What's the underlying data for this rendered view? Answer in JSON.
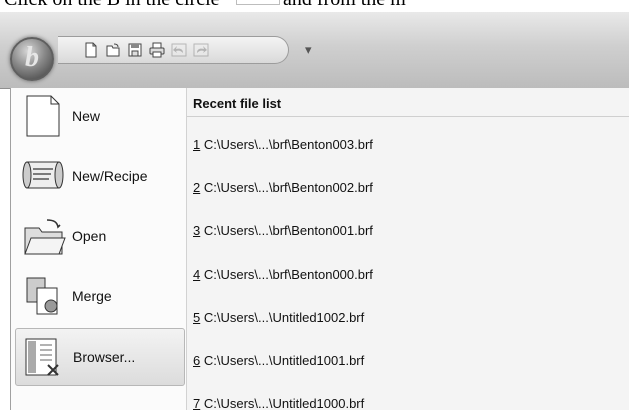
{
  "caption": {
    "left": "Click on the B in the circle",
    "right": "and from the m"
  },
  "app": {
    "orb_letter": "b"
  },
  "quick_access": {
    "icons": [
      "new-document-icon",
      "open-folder-icon",
      "save-icon",
      "print-icon",
      "undo-icon",
      "redo-icon"
    ],
    "more": "▾"
  },
  "menu": {
    "commands": [
      {
        "label": "New",
        "icon": "blank-document-icon"
      },
      {
        "label": "New/Recipe",
        "icon": "recipe-scroll-icon"
      },
      {
        "label": "Open",
        "icon": "folder-open-icon"
      },
      {
        "label": "Merge",
        "icon": "merge-documents-icon"
      },
      {
        "label": "Browser...",
        "icon": "browser-icon",
        "highlighted": true
      }
    ]
  },
  "recent": {
    "title": "Recent file list",
    "files": [
      {
        "num": "1",
        "path": " C:\\Users\\...\\brf\\Benton003.brf"
      },
      {
        "num": "2",
        "path": " C:\\Users\\...\\brf\\Benton002.brf"
      },
      {
        "num": "3",
        "path": " C:\\Users\\...\\brf\\Benton001.brf"
      },
      {
        "num": "4",
        "path": " C:\\Users\\...\\brf\\Benton000.brf"
      },
      {
        "num": "5",
        "path": " C:\\Users\\...\\Untitled1002.brf"
      },
      {
        "num": "6",
        "path": " C:\\Users\\...\\Untitled1001.brf"
      },
      {
        "num": "7",
        "path": " C:\\Users\\...\\Untitled1000.brf"
      }
    ]
  }
}
